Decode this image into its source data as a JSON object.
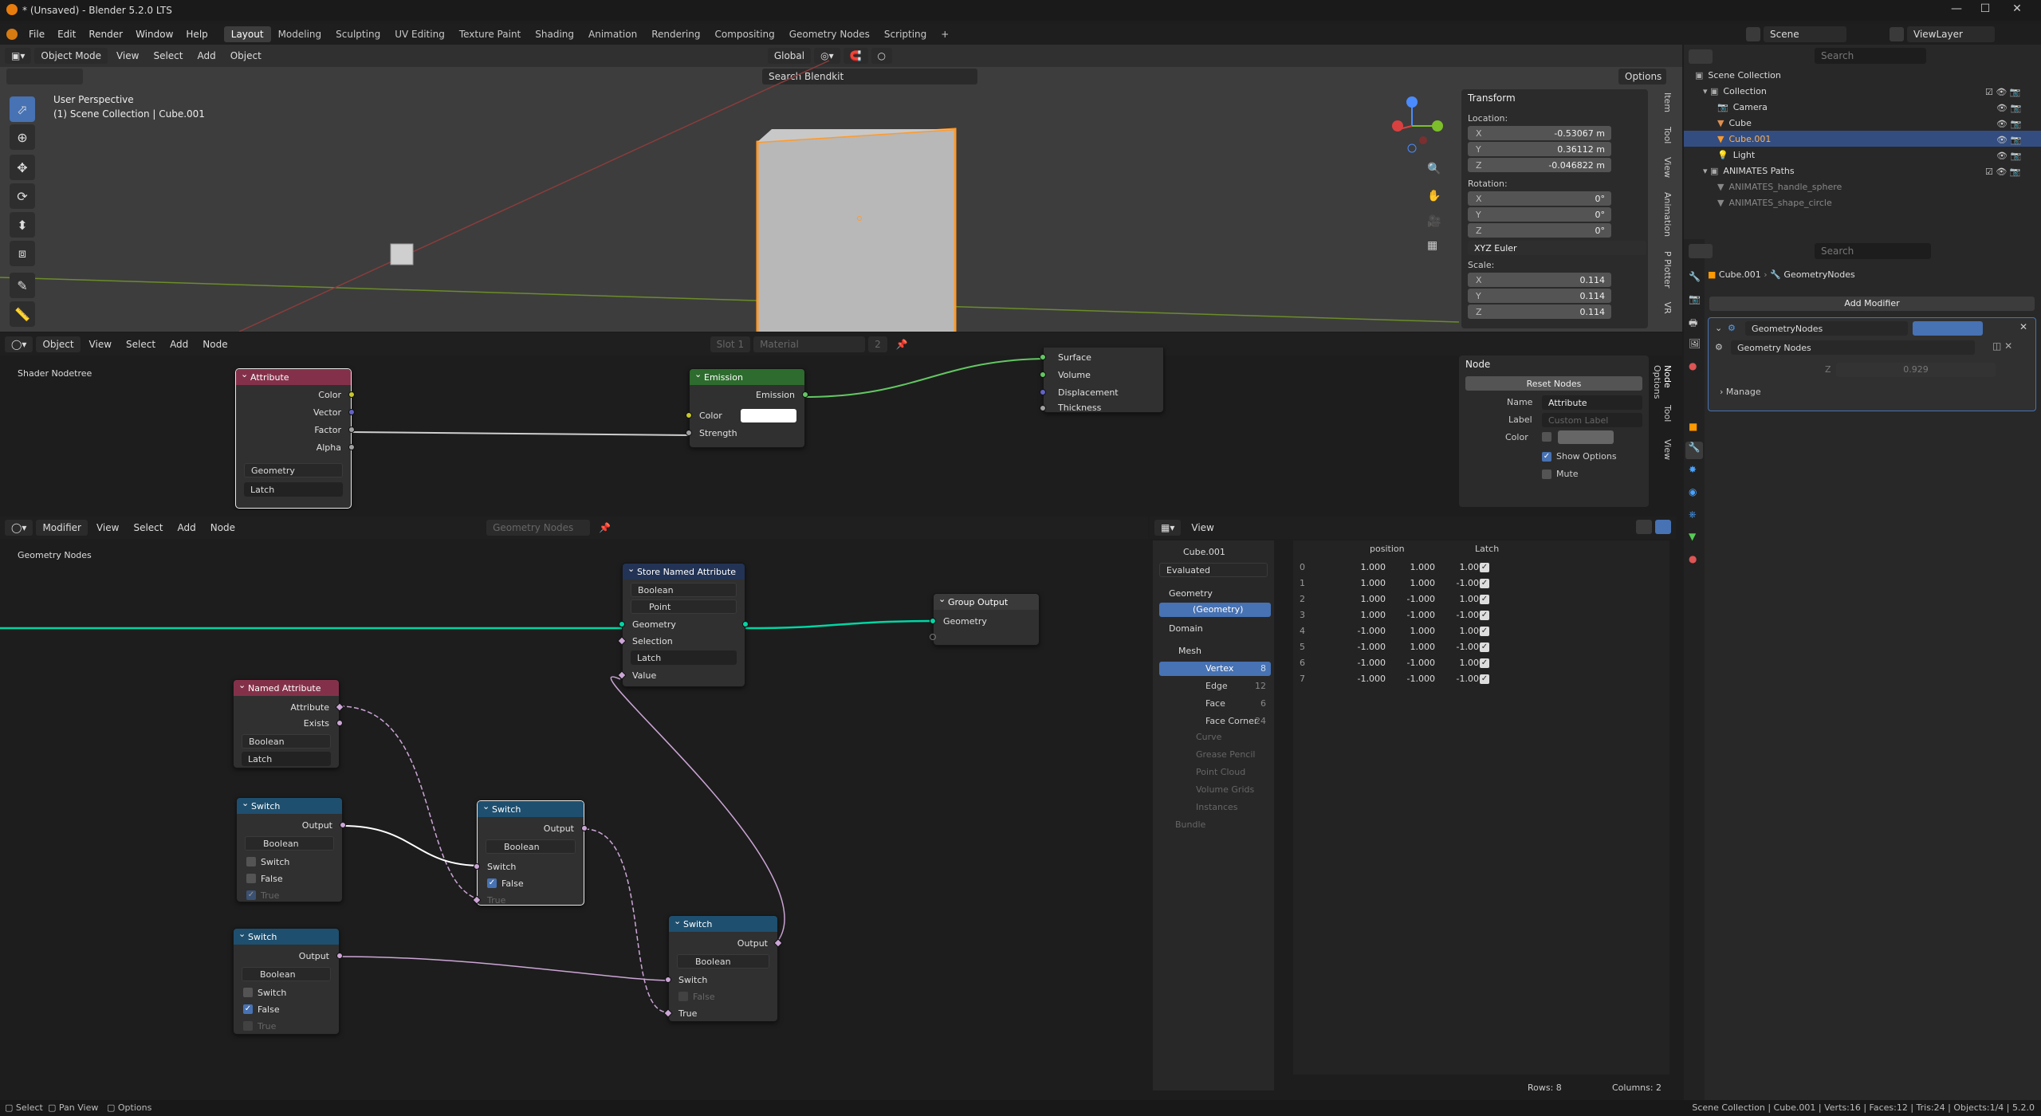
{
  "window": {
    "title": "* (Unsaved) - Blender 5.2.0 LTS"
  },
  "menu": [
    "File",
    "Edit",
    "Render",
    "Window",
    "Help"
  ],
  "workspaces": [
    "Layout",
    "Modeling",
    "Sculpting",
    "UV Editing",
    "Texture Paint",
    "Shading",
    "Animation",
    "Rendering",
    "Compositing",
    "Geometry Nodes",
    "Scripting"
  ],
  "top": {
    "scene": "Scene",
    "view_layer": "ViewLayer",
    "search_placeholder": "Search"
  },
  "viewport": {
    "mode": "Object Mode",
    "menus": [
      "View",
      "Select",
      "Add",
      "Object"
    ],
    "orientation": "Global",
    "search_placeholder": "Search Blendkit",
    "options": "Options",
    "info_line1": "User Perspective",
    "info_line2": "(1) Scene Collection | Cube.001",
    "gizmo": {
      "x": "X",
      "y": "Y",
      "z": "Z"
    }
  },
  "transform": {
    "title": "Transform",
    "location_label": "Location:",
    "loc": {
      "x": "-0.53067 m",
      "y": "0.36112 m",
      "z": "-0.046822 m"
    },
    "rotation_label": "Rotation:",
    "rot": {
      "x": "0°",
      "y": "0°",
      "z": "0°"
    },
    "rotation_mode": "XYZ Euler",
    "scale_label": "Scale:",
    "scale": {
      "x": "0.114",
      "y": "0.114",
      "z": "0.114"
    },
    "axis": {
      "x": "X",
      "y": "Y",
      "z": "Z"
    }
  },
  "npanel_tabs": [
    "Item",
    "Tool",
    "View",
    "Animation",
    "P Plotter",
    "VR"
  ],
  "shader_editor": {
    "mode": "Object",
    "menus": [
      "View",
      "Select",
      "Add",
      "Node"
    ],
    "slot": "Slot 1",
    "material": "Material",
    "material_users": "2",
    "breadcrumb": "Shader Nodetree",
    "attribute": {
      "title": "Attribute",
      "outputs": [
        "Color",
        "Vector",
        "Factor",
        "Alpha"
      ],
      "type": "Geometry",
      "name": "Latch"
    },
    "emission": {
      "title": "Emission",
      "output": "Emission",
      "inputs": [
        "Color",
        "Strength"
      ]
    },
    "output_sockets": [
      "Surface",
      "Volume",
      "Displacement",
      "Thickness"
    ],
    "node_panel": {
      "title": "Node",
      "reset": "Reset Nodes",
      "name_label": "Name",
      "name": "Attribute",
      "label_label": "Label",
      "label_placeholder": "Custom Label",
      "color_label": "Color",
      "show_options": "Show Options",
      "mute": "Mute"
    },
    "tabs": [
      "Node",
      "Tool",
      "View",
      "Options"
    ]
  },
  "geo_editor": {
    "mode": "Modifier",
    "menus": [
      "View",
      "Select",
      "Add",
      "Node"
    ],
    "tree": "Geometry Nodes",
    "breadcrumb": "Geometry Nodes",
    "store": {
      "title": "Store Named Attribute",
      "type": "Boolean",
      "domain": "Point",
      "inputs": [
        "Geometry",
        "Selection"
      ],
      "name": "Latch",
      "value": "Value",
      "output": "Geometry"
    },
    "group_output": {
      "title": "Group Output",
      "input": "Geometry"
    },
    "named": {
      "title": "Named Attribute",
      "outputs": [
        "Attribute",
        "Exists"
      ],
      "type": "Boolean",
      "name": "Latch"
    },
    "switch1": {
      "title": "Switch",
      "output": "Output",
      "type": "Boolean",
      "inputs": [
        "Switch",
        "False",
        "True"
      ]
    },
    "switch2": {
      "title": "Switch",
      "output": "Output",
      "type": "Boolean",
      "inputs": [
        "Switch",
        "False",
        "True"
      ]
    },
    "switch3": {
      "title": "Switch",
      "output": "Output",
      "type": "Boolean",
      "inputs": [
        "Switch",
        "False",
        "True"
      ]
    },
    "switch4": {
      "title": "Switch",
      "output": "Output",
      "type": "Boolean",
      "inputs": [
        "Switch",
        "False",
        "True"
      ]
    }
  },
  "spreadsheet": {
    "view": "View",
    "object": "Cube.001",
    "evaluated": "Evaluated",
    "geometry_label": "Geometry",
    "geometry": "(Geometry)",
    "domain_label": "Domain",
    "mesh": "Mesh",
    "domains": [
      {
        "name": "Vertex",
        "count": "8"
      },
      {
        "name": "Edge",
        "count": "12"
      },
      {
        "name": "Face",
        "count": "6"
      },
      {
        "name": "Face Corner",
        "count": "24"
      }
    ],
    "other_types": [
      "Curve",
      "Grease Pencil",
      "Point Cloud",
      "Volume Grids",
      "Instances",
      "Bundle"
    ],
    "columns": [
      "position",
      "Latch"
    ],
    "rows": [
      [
        "0",
        "1.000",
        "1.000",
        "1.000"
      ],
      [
        "1",
        "1.000",
        "1.000",
        "-1.000"
      ],
      [
        "2",
        "1.000",
        "-1.000",
        "1.000"
      ],
      [
        "3",
        "1.000",
        "-1.000",
        "-1.000"
      ],
      [
        "4",
        "-1.000",
        "1.000",
        "1.000"
      ],
      [
        "5",
        "-1.000",
        "1.000",
        "-1.000"
      ],
      [
        "6",
        "-1.000",
        "-1.000",
        "1.000"
      ],
      [
        "7",
        "-1.000",
        "-1.000",
        "-1.000"
      ]
    ],
    "footer_rows": "Rows: 8",
    "footer_cols": "Columns: 2"
  },
  "outliner": {
    "root": "Scene Collection",
    "items": [
      "Collection",
      "Camera",
      "Cube",
      "Cube.001",
      "Light",
      "ANIMATES Paths",
      "ANIMATES_handle_sphere",
      "ANIMATES_shape_circle"
    ]
  },
  "properties": {
    "search_placeholder": "Search",
    "object": "Cube.001",
    "tab": "GeometryNodes",
    "add_modifier": "Add Modifier",
    "modifier_name": "GeometryNodes",
    "node_group": "Geometry Nodes",
    "z_label": "Z",
    "z_value": "0.929",
    "manage": "Manage"
  },
  "status": {
    "left": [
      "Select",
      "Pan View",
      "Options"
    ],
    "right": "Scene Collection | Cube.001 | Verts:16 | Faces:12 | Tris:24 | Objects:1/4 | 5.2.0"
  },
  "colors": {
    "select": "#4772b3",
    "active_orange": "#ff9a2a",
    "geo_wire": "#00d6a3",
    "bool_wire": "#cca6d6"
  }
}
